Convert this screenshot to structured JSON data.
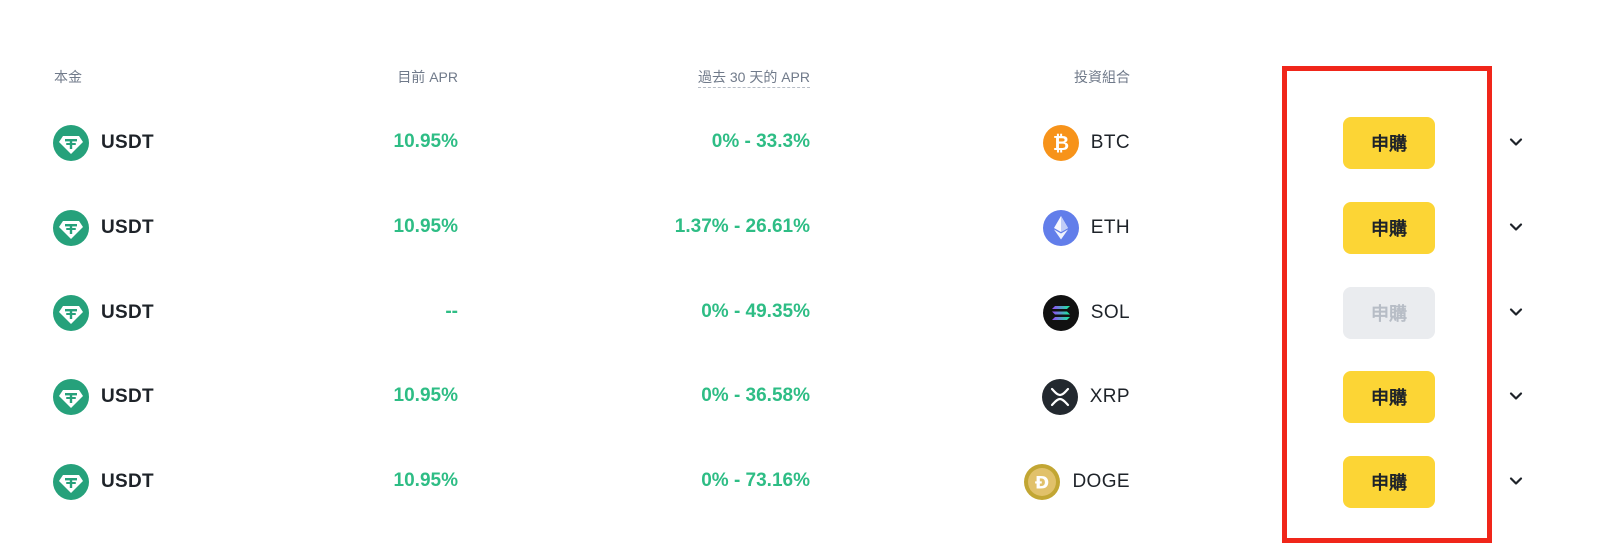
{
  "headers": {
    "principal": "本金",
    "current_apr": "目前 APR",
    "apr_30d": "過去 30 天的 APR",
    "portfolio": "投資組合"
  },
  "colors": {
    "accent_green": "#2ebd85",
    "subscribe_yellow": "#fcd535",
    "disabled_gray": "#eaecef",
    "highlight_red": "#f0261a",
    "tether_green": "#26a17b"
  },
  "rows": [
    {
      "coin": "USDT",
      "coin_icon": "tether-icon",
      "current_apr": "10.95%",
      "apr_30d": "0% - 33.3%",
      "asset": "BTC",
      "asset_icon": "bitcoin-icon",
      "button": "申購",
      "button_enabled": true
    },
    {
      "coin": "USDT",
      "coin_icon": "tether-icon",
      "current_apr": "10.95%",
      "apr_30d": "1.37% - 26.61%",
      "asset": "ETH",
      "asset_icon": "ethereum-icon",
      "button": "申購",
      "button_enabled": true
    },
    {
      "coin": "USDT",
      "coin_icon": "tether-icon",
      "current_apr": "--",
      "apr_30d": "0% - 49.35%",
      "asset": "SOL",
      "asset_icon": "solana-icon",
      "button": "申購",
      "button_enabled": false
    },
    {
      "coin": "USDT",
      "coin_icon": "tether-icon",
      "current_apr": "10.95%",
      "apr_30d": "0% - 36.58%",
      "asset": "XRP",
      "asset_icon": "xrp-icon",
      "button": "申購",
      "button_enabled": true
    },
    {
      "coin": "USDT",
      "coin_icon": "tether-icon",
      "current_apr": "10.95%",
      "apr_30d": "0% - 73.16%",
      "asset": "DOGE",
      "asset_icon": "dogecoin-icon",
      "button": "申購",
      "button_enabled": true
    }
  ]
}
